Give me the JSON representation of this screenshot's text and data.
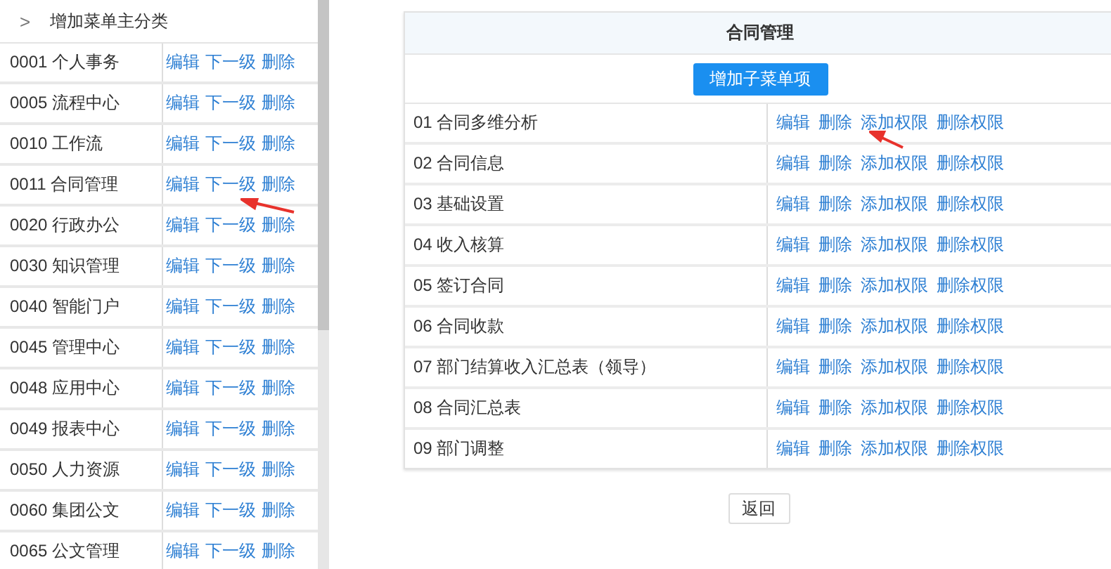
{
  "sidebar": {
    "header": {
      "icon": ">",
      "label": "增加菜单主分类"
    },
    "items": [
      {
        "label": "0001 个人事务",
        "actions": [
          "编辑",
          "下一级",
          "删除"
        ]
      },
      {
        "label": "0005 流程中心",
        "actions": [
          "编辑",
          "下一级",
          "删除"
        ]
      },
      {
        "label": "0010 工作流",
        "actions": [
          "编辑",
          "下一级",
          "删除"
        ]
      },
      {
        "label": "0011 合同管理",
        "actions": [
          "编辑",
          "下一级",
          "删除"
        ]
      },
      {
        "label": "0020 行政办公",
        "actions": [
          "编辑",
          "下一级",
          "删除"
        ]
      },
      {
        "label": "0030 知识管理",
        "actions": [
          "编辑",
          "下一级",
          "删除"
        ]
      },
      {
        "label": "0040 智能门户",
        "actions": [
          "编辑",
          "下一级",
          "删除"
        ]
      },
      {
        "label": "0045 管理中心",
        "actions": [
          "编辑",
          "下一级",
          "删除"
        ]
      },
      {
        "label": "0048 应用中心",
        "actions": [
          "编辑",
          "下一级",
          "删除"
        ]
      },
      {
        "label": "0049 报表中心",
        "actions": [
          "编辑",
          "下一级",
          "删除"
        ]
      },
      {
        "label": "0050 人力资源",
        "actions": [
          "编辑",
          "下一级",
          "删除"
        ]
      },
      {
        "label": "0060 集团公文",
        "actions": [
          "编辑",
          "下一级",
          "删除"
        ]
      },
      {
        "label": "0065 公文管理",
        "actions": [
          "编辑",
          "下一级",
          "删除"
        ]
      }
    ]
  },
  "panel": {
    "title": "合同管理",
    "add_button": "增加子菜单项",
    "rows": [
      {
        "label": "01 合同多维分析",
        "actions": [
          "编辑",
          "删除",
          "添加权限",
          "删除权限"
        ]
      },
      {
        "label": "02 合同信息",
        "actions": [
          "编辑",
          "删除",
          "添加权限",
          "删除权限"
        ]
      },
      {
        "label": "03 基础设置",
        "actions": [
          "编辑",
          "删除",
          "添加权限",
          "删除权限"
        ]
      },
      {
        "label": "04 收入核算",
        "actions": [
          "编辑",
          "删除",
          "添加权限",
          "删除权限"
        ]
      },
      {
        "label": "05 签订合同",
        "actions": [
          "编辑",
          "删除",
          "添加权限",
          "删除权限"
        ]
      },
      {
        "label": "06 合同收款",
        "actions": [
          "编辑",
          "删除",
          "添加权限",
          "删除权限"
        ]
      },
      {
        "label": "07 部门结算收入汇总表（领导）",
        "actions": [
          "编辑",
          "删除",
          "添加权限",
          "删除权限"
        ]
      },
      {
        "label": "08 合同汇总表",
        "actions": [
          "编辑",
          "删除",
          "添加权限",
          "删除权限"
        ]
      },
      {
        "label": "09 部门调整",
        "actions": [
          "编辑",
          "删除",
          "添加权限",
          "删除权限"
        ]
      }
    ]
  },
  "back_button": "返回"
}
